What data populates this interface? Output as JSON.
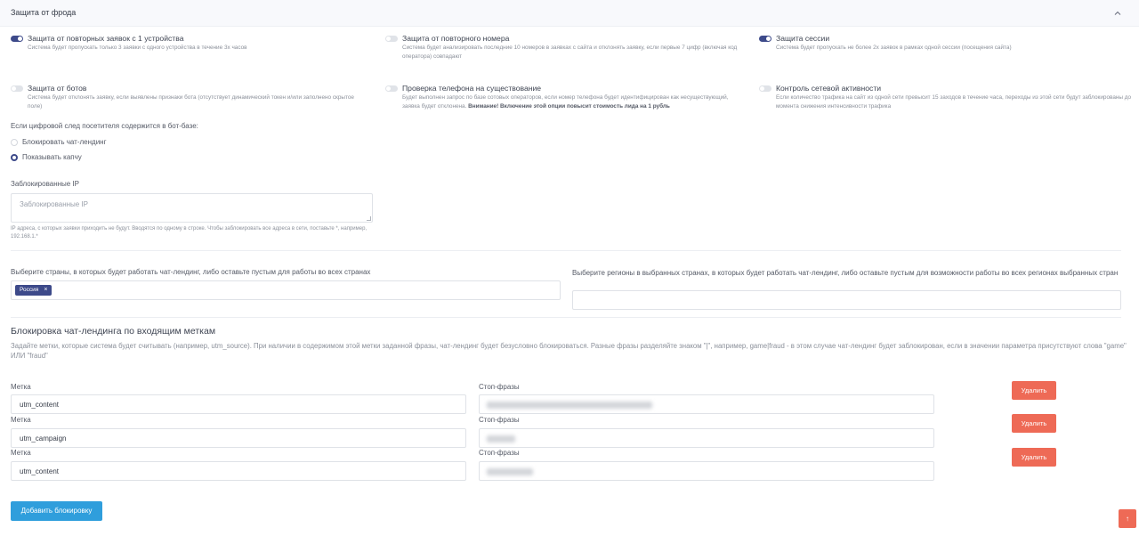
{
  "panel": {
    "title": "Защита от фрода"
  },
  "options": [
    {
      "title": "Защита от повторных заявок с 1 устройства",
      "on": true,
      "desc": "Система будет пропускать только 3 заявки с одного устройства в течение 3х часов"
    },
    {
      "title": "Защита от повторного номера",
      "on": false,
      "desc": "Система будет анализировать последние 10 номеров в заявках с сайта и отклонять заявку, если первые 7 цифр (включая код оператора) совпадают"
    },
    {
      "title": "Защита сессии",
      "on": true,
      "desc": "Система будет пропускать не более 2х заявок в рамках одной сессии (посещения сайта)"
    },
    {
      "title": "Защита от ботов",
      "on": false,
      "desc": "Система будет отклонять заявку, если выявлены признаки бота (отсутствует динамический токен и/или заполнено скрытое поле)"
    },
    {
      "title": "Проверка телефона на существование",
      "on": false,
      "desc": "Будет выполнен запрос по базе сотовых операторов, если номер телефона будет идентифицирован как несуществующий, заявка будет отклонена.",
      "desc_bold": "Внимание! Включение этой опции повысит стоимость лида на 1 рубль"
    },
    {
      "title": "Контроль сетевой активности",
      "on": false,
      "desc": "Если количество трафика на сайт из одной сети превысит 15 заходов в течение часа, переходы из этой сети будут заблокированы до момента снижения интенсивности трафика"
    }
  ],
  "botbase": {
    "label": "Если цифровой след посетителя содержится в бот-базе:",
    "options": [
      {
        "label": "Блокировать чат-лендинг",
        "selected": false
      },
      {
        "label": "Показывать капчу",
        "selected": true
      }
    ]
  },
  "blocked_ip": {
    "label": "Заблокированные IP",
    "placeholder": "Заблокированные IP",
    "hint": "IP адреса, с которых заявки приходить не будут. Вводятся по одному в строке. Чтобы заблокировать все адреса в сети, поставьте *, например, 192.168.1.*"
  },
  "countries": {
    "label": "Выберите страны, в которых будет работать чат-лендинг, либо оставьте пустым для работы во всех странах",
    "tags": [
      "Россия"
    ],
    "tag_remove": "×"
  },
  "regions": {
    "label": "Выберите регионы в выбранных странах, в которых будет работать чат-лендинг, либо оставьте пустым для возможности работы во всех регионах выбранных стран"
  },
  "utm_block": {
    "title": "Блокировка чат-лендинга по входящим меткам",
    "desc": "Задайте метки, которые система будет считывать (например, utm_source). При наличии в содержимом этой метки заданной фразы, чат-лендинг будет безусловно блокироваться. Разные фразы разделяйте знаком \"|\", например, game|fraud - в этом случае чат-лендинг будет заблокирован, если в значении параметра присутствуют слова \"game\" ИЛИ \"fraud\"",
    "rows": [
      {
        "label_tag": "Метка",
        "tag": "utm_content",
        "label_phrases": "Стоп-фразы",
        "delete": "Удалить"
      },
      {
        "label_tag": "Метка",
        "tag": "utm_campaign",
        "label_phrases": "Стоп-фразы",
        "delete": "Удалить"
      },
      {
        "label_tag": "Метка",
        "tag": "utm_content",
        "label_phrases": "Стоп-фразы",
        "delete": "Удалить"
      }
    ],
    "add_button": "Добавить блокировку"
  },
  "scroll_top": "↑"
}
